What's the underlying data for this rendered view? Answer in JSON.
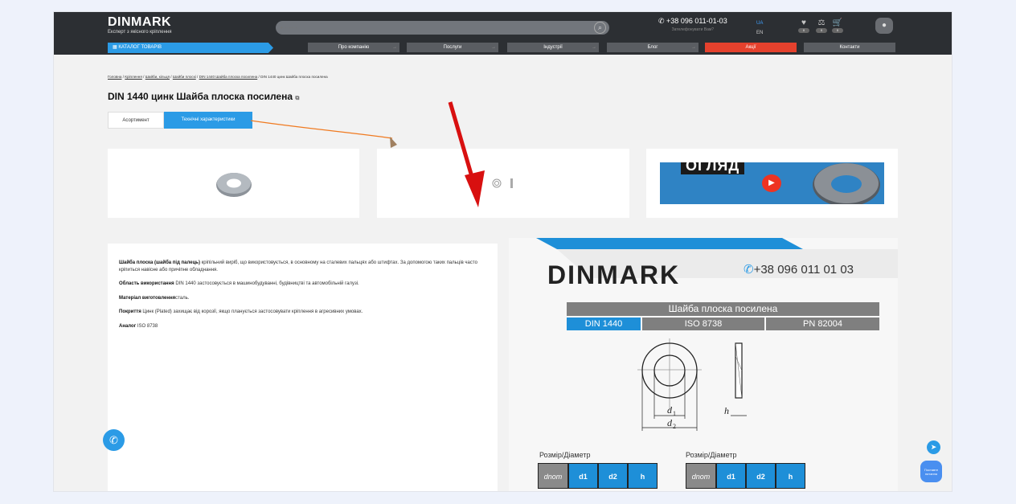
{
  "header": {
    "logo": "DINMARK",
    "tagline": "Експерт з якісного кріплення",
    "search_placeholder": "• ······",
    "phone": "+38 096 011-01-03",
    "callback": "Зателефонувати Вам?",
    "lang_ua": "UA",
    "lang_en": "EN",
    "favorites_count": "0",
    "compare_count": "0",
    "cart_count": "0"
  },
  "nav": {
    "catalog": "КАТАЛОГ ТОВАРІВ",
    "about": "Про компанію",
    "services": "Послуги",
    "industries": "Індустрії",
    "blog": "Блог",
    "promo": "Акції",
    "contacts": "Контакти"
  },
  "breadcrumb": {
    "home": "Головна",
    "fasteners": "Кріплення",
    "washers": "Шайби, кільця",
    "flat_washers": "Шайби плоскі",
    "din1440": "DIN 1440 Шайба плоска посилена",
    "current": "DIN 1440 цинк Шайба плоска посилена"
  },
  "page_title": "DIN 1440 цинк Шайба плоска посилена",
  "tabs": {
    "assortment": "Асортимент",
    "tech": "Технічні характеристики"
  },
  "video": {
    "title": "ОГЛЯД"
  },
  "description": {
    "p1_bold": "Шайба плоска (шайба під палець)",
    "p1_text": " кріпільний виріб, що використовується, в основному на сталевих пальцях або штифтах. За допомогою таких пальців часто кріпиться навісне або причіпне обладнання.",
    "p2_bold": "Область використання",
    "p2_text": " DIN 1440 застосовується в машинобудуванні, будівництві та автомобільній галузі.",
    "p3_bold": "Матеріал виготовлення",
    "p3_text": "сталь.",
    "p4_bold": "Покриття",
    "p4_text": " Цинк (Plated) захищає від корозії, якщо планується застосовувати кріплення в агресивних умовах.",
    "p5_bold": "Аналог",
    "p5_text": " ISO 8738"
  },
  "spec": {
    "logo": "DINMARK",
    "phone": "+38 096 011 01 03",
    "name": "Шайба плоска посилена",
    "std1": "DIN 1440",
    "std2": "ISO 8738",
    "std3": "PN 82004",
    "d1_label": "d",
    "d1_sub": "1",
    "d2_label": "d",
    "d2_sub": "2",
    "h_label": "h",
    "table_label_left": "Розмір/Діаметр",
    "table_label_right": "Розмір/Діаметр",
    "col_dnom": "dnom",
    "col_d1": "d1",
    "col_d2": "d2",
    "col_h": "h"
  },
  "widgets": {
    "ask": "Поставте питання"
  },
  "colors": {
    "accent": "#2b9be6",
    "header_bg": "#2c2f33",
    "promo": "#e5412d",
    "arrow_red": "#d81010"
  }
}
